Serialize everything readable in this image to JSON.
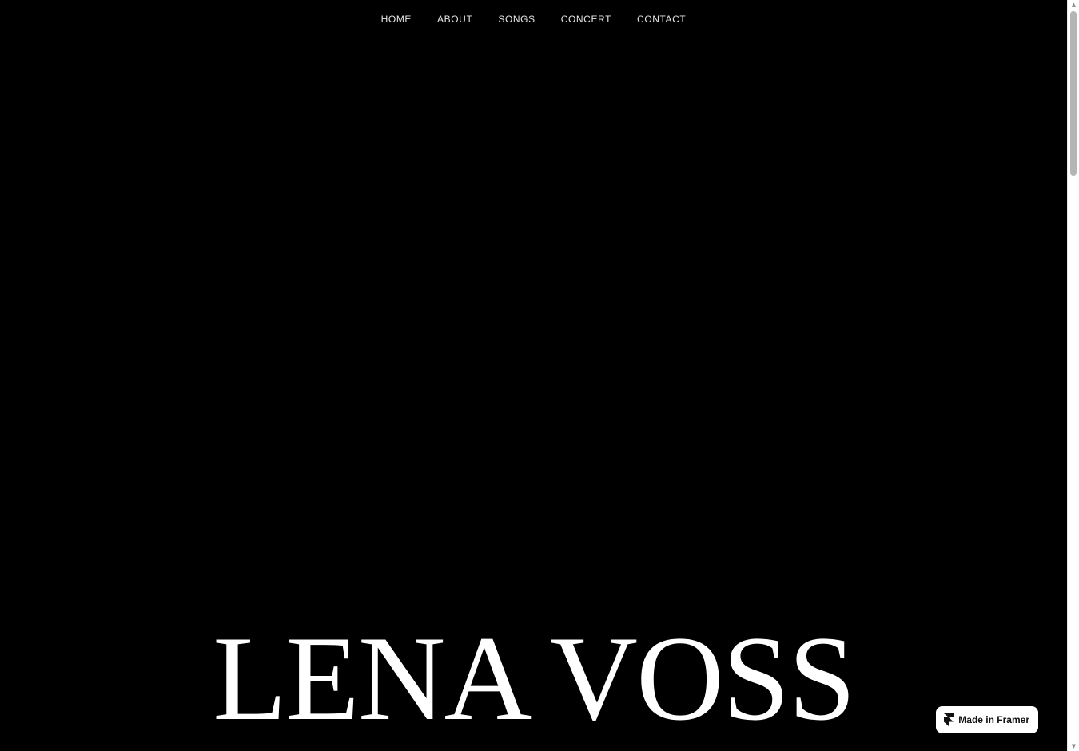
{
  "nav": {
    "items": [
      {
        "label": "HOME"
      },
      {
        "label": "ABOUT"
      },
      {
        "label": "SONGS"
      },
      {
        "label": "CONCERT"
      },
      {
        "label": "CONTACT"
      }
    ]
  },
  "hero": {
    "title": "LENA VOSS"
  },
  "badge": {
    "label": "Made in Framer",
    "icon": "framer-icon"
  },
  "scrollbar": {
    "up_icon": "▲",
    "down_icon": "▼",
    "position": 0.0
  },
  "colors": {
    "background": "#000000",
    "text": "#ffffff",
    "nav_text": "#e6e6e6",
    "badge_bg": "#ffffff"
  }
}
